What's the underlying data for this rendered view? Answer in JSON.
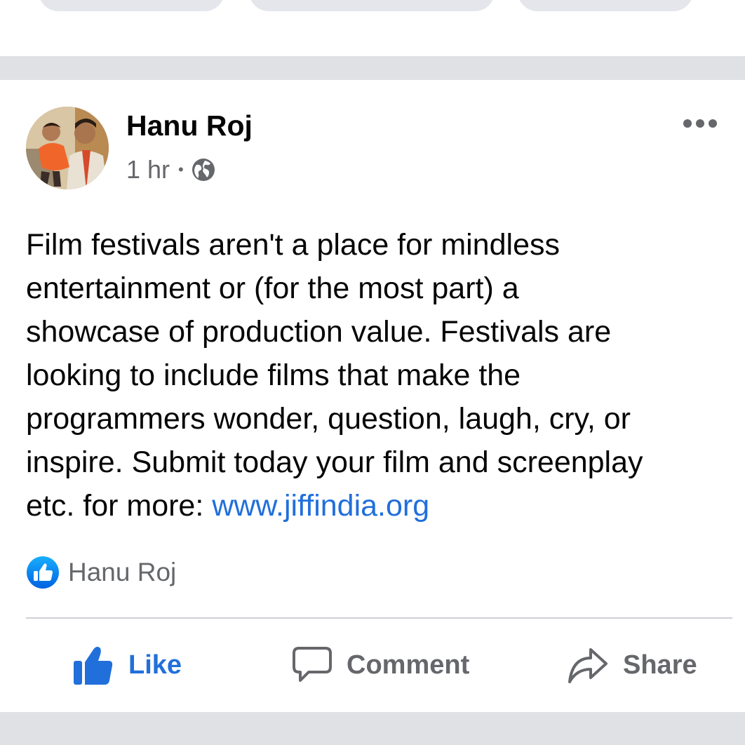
{
  "post": {
    "author": "Hanu Roj",
    "time": "1 hr",
    "separator": "•",
    "privacy_icon": "globe-icon",
    "more_icon": "more-horizontal-icon",
    "text_lines": [
      "Film festivals aren't a place for mindless",
      "entertainment or (for the most part) a",
      "showcase of production value. Festivals are",
      "looking to include films that make the",
      "programmers wonder, question, laugh, cry, or",
      "inspire. Submit today your film and screenplay"
    ],
    "last_line_prefix": "etc. for more: ",
    "link_text": "www.jiffindia.org",
    "reactions": {
      "icon": "like-reaction-icon",
      "names": "Hanu Roj"
    }
  },
  "actions": {
    "like_label": "Like",
    "comment_label": "Comment",
    "share_label": "Share"
  },
  "colors": {
    "accent": "#216fdb",
    "muted_text": "#65676b",
    "separator": "#dfe1e5"
  }
}
